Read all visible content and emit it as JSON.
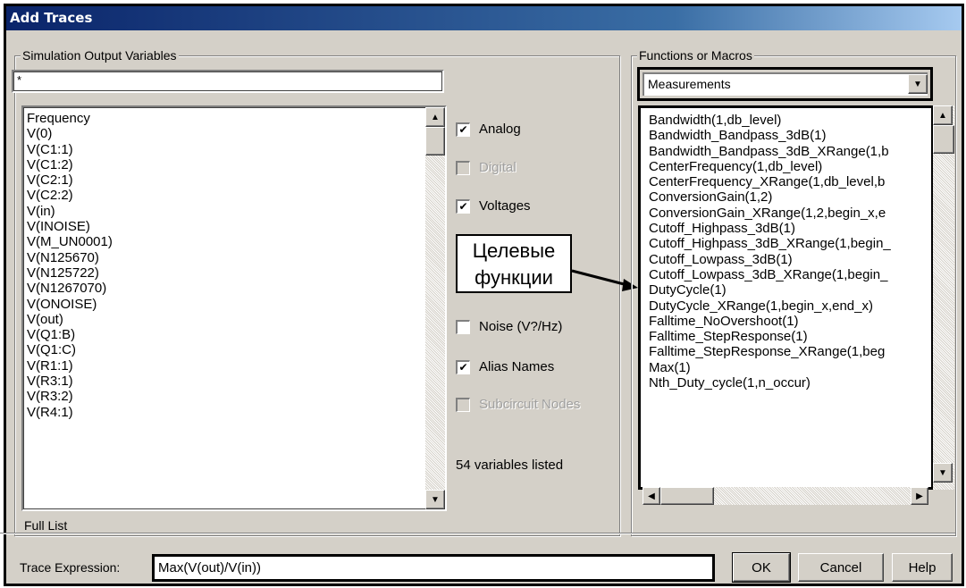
{
  "window": {
    "title": "Add Traces"
  },
  "output_vars": {
    "group_label": "Simulation Output Variables",
    "filter_value": "*",
    "items": [
      "Frequency",
      "V(0)",
      "V(C1:1)",
      "V(C1:2)",
      "V(C2:1)",
      "V(C2:2)",
      "V(in)",
      "V(INOISE)",
      "V(M_UN0001)",
      "V(N125670)",
      "V(N125722)",
      "V(N1267070)",
      "V(ONOISE)",
      "V(out)",
      "V(Q1:B)",
      "V(Q1:C)",
      "V(R1:1)",
      "V(R3:1)",
      "V(R3:2)",
      "V(R4:1)"
    ],
    "footer": "Full List"
  },
  "options": {
    "analog": {
      "label": "Analog",
      "checked": true
    },
    "digital": {
      "label": "Digital",
      "checked": false,
      "disabled": true
    },
    "voltages": {
      "label": "Voltages",
      "checked": true
    },
    "noise": {
      "label": "Noise (V?/Hz)",
      "checked": false
    },
    "alias_names": {
      "label": "Alias Names",
      "checked": true
    },
    "subcircuit_nodes": {
      "label": "Subcircuit Nodes",
      "checked": false,
      "disabled": true
    },
    "count_text": "54 variables listed"
  },
  "annotation": {
    "line1": "Целевые",
    "line2": "функции"
  },
  "functions": {
    "group_label": "Functions or Macros",
    "selected": "Measurements",
    "items": [
      "Bandwidth(1,db_level)",
      "Bandwidth_Bandpass_3dB(1)",
      "Bandwidth_Bandpass_3dB_XRange(1,b",
      "CenterFrequency(1,db_level)",
      "CenterFrequency_XRange(1,db_level,b",
      "ConversionGain(1,2)",
      "ConversionGain_XRange(1,2,begin_x,e",
      "Cutoff_Highpass_3dB(1)",
      "Cutoff_Highpass_3dB_XRange(1,begin_",
      "Cutoff_Lowpass_3dB(1)",
      "Cutoff_Lowpass_3dB_XRange(1,begin_",
      "DutyCycle(1)",
      "DutyCycle_XRange(1,begin_x,end_x)",
      "Falltime_NoOvershoot(1)",
      "Falltime_StepResponse(1)",
      "Falltime_StepResponse_XRange(1,beg",
      "Max(1)",
      "Nth_Duty_cycle(1,n_occur)"
    ]
  },
  "trace": {
    "label": "Trace Expression:",
    "value": "Max(V(out)/V(in))"
  },
  "buttons": {
    "ok": "OK",
    "cancel": "Cancel",
    "help": "Help"
  },
  "icons": {
    "check": "checkmark-icon",
    "up": "arrow-up-icon",
    "down": "arrow-down-icon",
    "left": "arrow-left-icon",
    "right": "arrow-right-icon"
  }
}
